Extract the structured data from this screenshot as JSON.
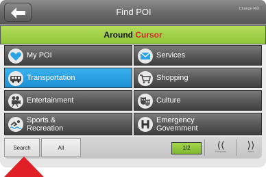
{
  "header": {
    "title": "Find POI",
    "change_ref_label": "Change Ref."
  },
  "banner": {
    "prefix": "Around",
    "keyword": "Cursor",
    "colors": {
      "bar": "#9fd049",
      "keyword": "#d9262b"
    }
  },
  "categories": [
    {
      "label": "My POI",
      "icon": "heart-icon",
      "selected": false
    },
    {
      "label": "Services",
      "icon": "envelope-icon",
      "selected": false
    },
    {
      "label": "Transportation",
      "icon": "bus-icon",
      "selected": true
    },
    {
      "label": "Shopping",
      "icon": "shopping-cart-icon",
      "selected": false
    },
    {
      "label": "Entertainment",
      "icon": "film-camera-icon",
      "selected": false
    },
    {
      "label": "Culture",
      "icon": "theater-masks-icon",
      "selected": false
    },
    {
      "label": "Sports &",
      "label2": "Recreation",
      "icon": "swimmer-icon",
      "selected": false
    },
    {
      "label": "Emergency",
      "label2": "Government",
      "icon": "hospital-h-icon",
      "selected": false
    }
  ],
  "toolbar": {
    "search_label": "Search",
    "all_label": "All",
    "page_indicator": "1/2",
    "previous_label": "Previous",
    "next_label": "Next"
  },
  "selection_color": "#2aa3e6"
}
